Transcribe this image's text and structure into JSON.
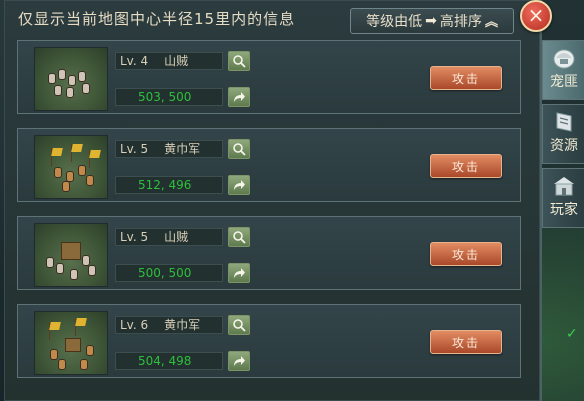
{
  "header": {
    "title": "仅显示当前地图中心半径15里内的信息",
    "sort_label": "等级由低",
    "sort_label2": "高排序",
    "arrow_glyph": "➡",
    "chevron_glyph": "︾",
    "close_glyph": "×"
  },
  "rows": [
    {
      "level": "Lv. 4",
      "name": "山贼",
      "coords": "503, 500",
      "attack_label": "攻击",
      "type": "bandit"
    },
    {
      "level": "Lv. 5",
      "name": "黄巾军",
      "coords": "512, 496",
      "attack_label": "攻击",
      "type": "yellow-turban"
    },
    {
      "level": "Lv. 5",
      "name": "山贼",
      "coords": "500, 500",
      "attack_label": "攻击",
      "type": "bandit-siege"
    },
    {
      "level": "Lv. 6",
      "name": "黄巾军",
      "coords": "504, 498",
      "attack_label": "攻击",
      "type": "yellow-turban"
    }
  ],
  "side_tabs": [
    {
      "label": "宠匪",
      "icon": "helmet-icon",
      "active": true
    },
    {
      "label": "资源",
      "icon": "scroll-icon",
      "active": false
    },
    {
      "label": "玩家",
      "icon": "castle-icon",
      "active": false
    }
  ],
  "colors": {
    "coord_green": "#2fbf3c",
    "attack_button": "#c8663f",
    "close_red": "#d0432f"
  }
}
